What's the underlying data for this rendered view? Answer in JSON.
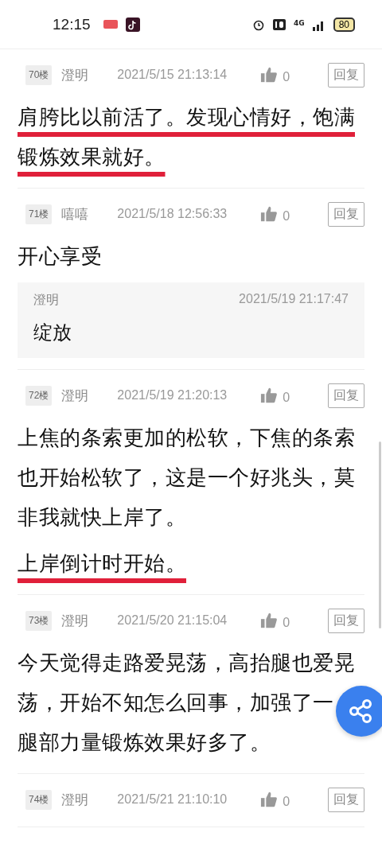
{
  "status_bar": {
    "time": "12:15",
    "network": "4G",
    "battery": "80"
  },
  "posts": [
    {
      "floor": "70楼",
      "author": "澄明",
      "date": "2021/5/15 21:13:14",
      "likes": "0",
      "reply_label": "回复",
      "paragraphs": [
        {
          "text": "肩胯比以前活了。发现心情好，饱满锻炼效果就好。",
          "underlined": true
        }
      ]
    },
    {
      "floor": "71楼",
      "author": "嘻嘻",
      "date": "2021/5/18 12:56:33",
      "likes": "0",
      "reply_label": "回复",
      "paragraphs": [
        {
          "text": "开心享受",
          "underlined": false
        }
      ],
      "replies": [
        {
          "author": "澄明",
          "date": "2021/5/19 21:17:47",
          "text": "绽放"
        }
      ]
    },
    {
      "floor": "72楼",
      "author": "澄明",
      "date": "2021/5/19 21:20:13",
      "likes": "0",
      "reply_label": "回复",
      "paragraphs": [
        {
          "text": "上焦的条索更加的松软，下焦的条索也开始松软了，这是一个好兆头，莫非我就快上岸了。",
          "underlined": false
        },
        {
          "text": "上岸倒计时开始。",
          "underlined": true
        }
      ]
    },
    {
      "floor": "73楼",
      "author": "澄明",
      "date": "2021/5/20 21:15:04",
      "likes": "0",
      "reply_label": "回复",
      "paragraphs": [
        {
          "lines": [
            "今天觉得走路爱晃荡，高抬腿也爱晃",
            "荡，开始不知怎么回事，加强了一",
            "腿部力量锻炼效果好多了。"
          ],
          "underlined": false
        }
      ]
    },
    {
      "floor": "74楼",
      "author": "澄明",
      "date": "2021/5/21 21:10:10",
      "likes": "0",
      "reply_label": "回复"
    }
  ]
}
